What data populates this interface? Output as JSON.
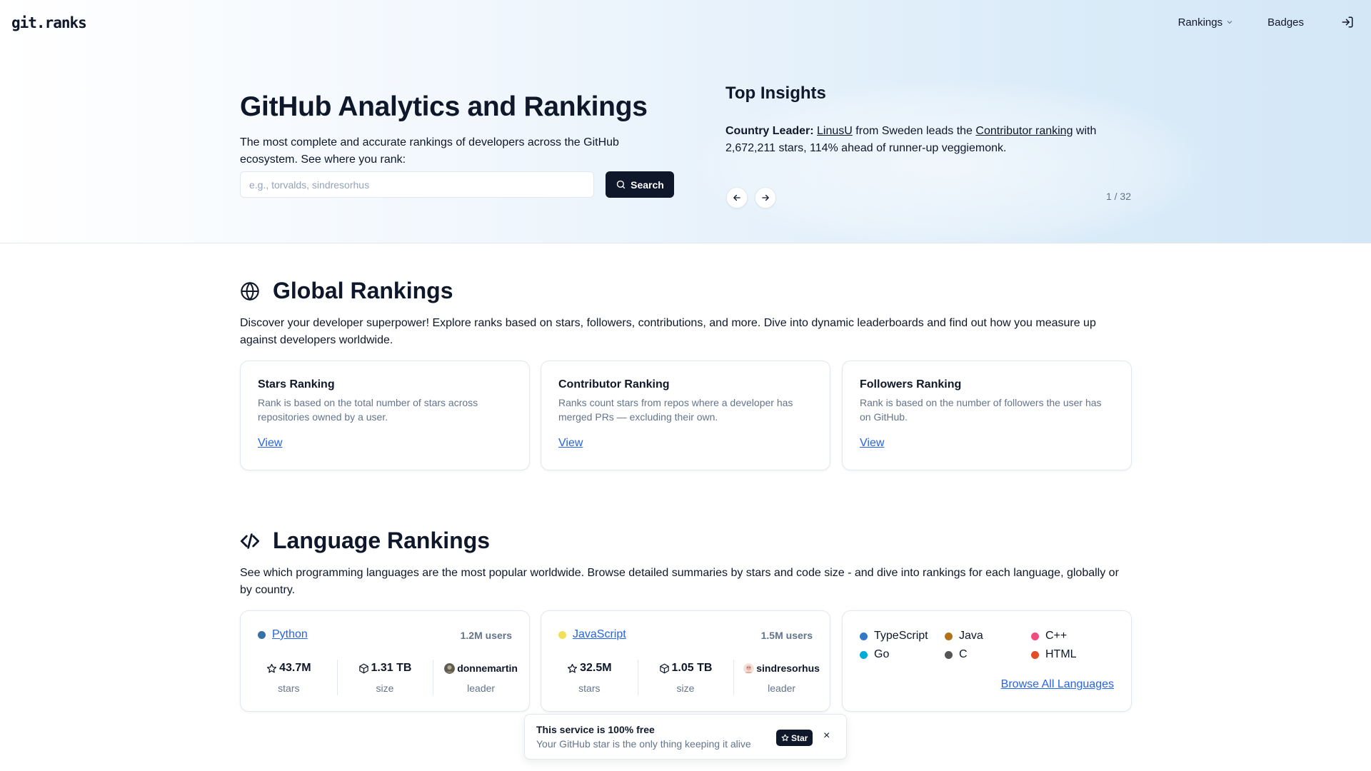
{
  "header": {
    "logo": "git.ranks",
    "nav": {
      "rankings": "Rankings",
      "badges": "Badges"
    }
  },
  "hero": {
    "title": "GitHub Analytics and Rankings",
    "description": "The most complete and accurate rankings of developers across the GitHub ecosystem. See where you rank:",
    "search": {
      "placeholder": "e.g., torvalds, sindresorhus",
      "button": "Search"
    }
  },
  "insights": {
    "title": "Top Insights",
    "label": "Country Leader:",
    "user": "LinusU",
    "text_a": " from Sweden leads the ",
    "ranking_link": "Contributor ranking",
    "text_b": " with 2,672,211 stars, 114% ahead of runner-up veggiemonk.",
    "page": "1 / 32"
  },
  "global": {
    "title": "Global Rankings",
    "description": "Discover your developer superpower! Explore ranks based on stars, followers, contributions, and more. Dive into dynamic leaderboards and find out how you measure up against developers worldwide.",
    "cards": [
      {
        "title": "Stars Ranking",
        "desc": "Rank is based on the total number of stars across repositories owned by a user.",
        "link": "View"
      },
      {
        "title": "Contributor Ranking",
        "desc": "Ranks count stars from repos where a developer has merged PRs — excluding their own.",
        "link": "View"
      },
      {
        "title": "Followers Ranking",
        "desc": "Rank is based on the number of followers the user has on GitHub.",
        "link": "View"
      }
    ]
  },
  "languages": {
    "title": "Language Rankings",
    "description": "See which programming languages are the most popular worldwide. Browse detailed summaries by stars and code size - and dive into rankings for each language, globally or by country.",
    "cards": [
      {
        "name": "Python",
        "color": "#3572A5",
        "users": "1.2M users",
        "stars": "43.7M",
        "stars_label": "stars",
        "size": "1.31 TB",
        "size_label": "size",
        "leader": "donnemartin",
        "leader_label": "leader"
      },
      {
        "name": "JavaScript",
        "color": "#f1e05a",
        "users": "1.5M users",
        "stars": "32.5M",
        "stars_label": "stars",
        "size": "1.05 TB",
        "size_label": "size",
        "leader": "sindresorhus",
        "leader_label": "leader"
      }
    ],
    "others": [
      {
        "name": "TypeScript",
        "color": "#3178c6"
      },
      {
        "name": "Java",
        "color": "#b07219"
      },
      {
        "name": "C++",
        "color": "#f34b7d"
      },
      {
        "name": "Go",
        "color": "#00ADD8"
      },
      {
        "name": "C",
        "color": "#555555"
      },
      {
        "name": "HTML",
        "color": "#e34c26"
      }
    ],
    "browse": "Browse All Languages"
  },
  "toast": {
    "title": "This service is 100% free",
    "subtitle": "Your GitHub star is the only thing keeping it alive",
    "star": "Star",
    "close": "×"
  }
}
